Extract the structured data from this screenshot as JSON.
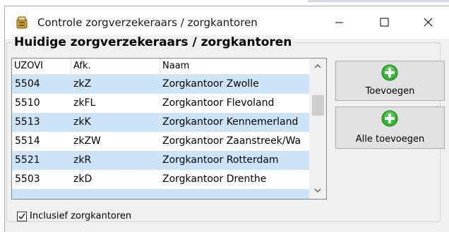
{
  "window": {
    "title": "Controle zorgverzekeraars / zorgkantoren",
    "minimize_glyph": "—",
    "maximize_glyph": "☐",
    "close_glyph": "✕"
  },
  "group": {
    "title": "Huidige zorgverzekeraars / zorgkantoren"
  },
  "grid": {
    "columns": [
      "UZOVI",
      "Afk.",
      "Naam"
    ],
    "rows": [
      {
        "uzovi": "5504",
        "afk": "zkZ",
        "naam": "Zorgkantoor Zwolle"
      },
      {
        "uzovi": "5510",
        "afk": "zkFL",
        "naam": "Zorgkantoor Flevoland"
      },
      {
        "uzovi": "5513",
        "afk": "zkK",
        "naam": "Zorgkantoor Kennemerland"
      },
      {
        "uzovi": "5514",
        "afk": "zkZW",
        "naam": "Zorgkantoor Zaanstreek/Wa"
      },
      {
        "uzovi": "5521",
        "afk": "zkR",
        "naam": "Zorgkantoor Rotterdam"
      },
      {
        "uzovi": "5503",
        "afk": "zkD",
        "naam": "Zorgkantoor Drenthe"
      }
    ]
  },
  "buttons": {
    "add_label": "Toevoegen",
    "add_all_label": "Alle toevoegen",
    "icon": "green-plus-icon"
  },
  "checkbox": {
    "label": "Inclusief zorgkantoren",
    "checked": true
  },
  "colors": {
    "row_highlight": "#cce4f7",
    "plus_green": "#2fb52f"
  }
}
